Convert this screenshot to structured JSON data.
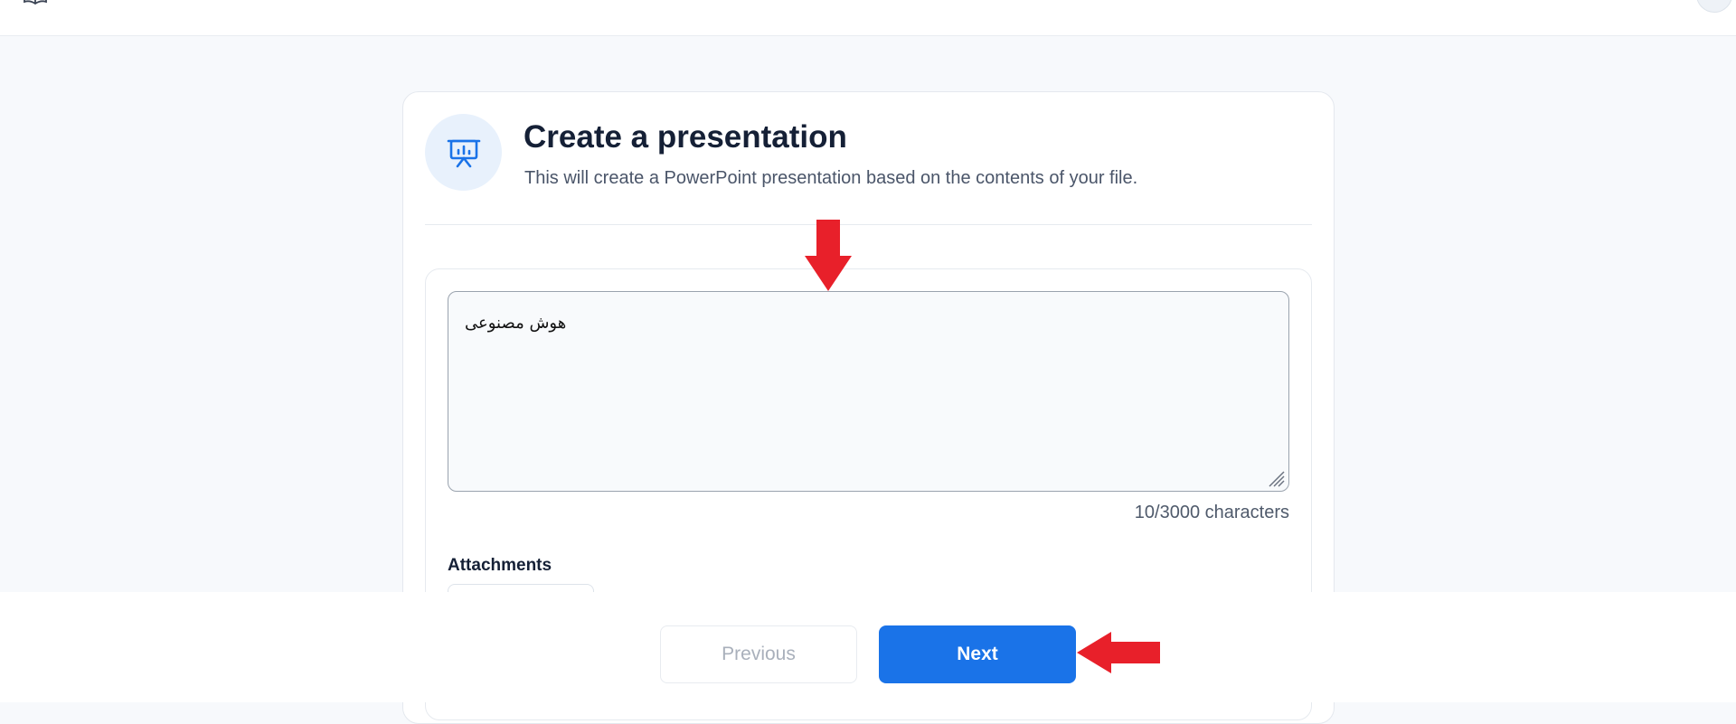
{
  "app": {
    "topbar": {
      "left_icon": "book-icon",
      "right_icon": "avatar"
    }
  },
  "card": {
    "icon": "presentation-board-icon",
    "title": "Create a presentation",
    "subtitle": "This will create a PowerPoint presentation based on the contents of your file.",
    "prompt": {
      "value": "هوش مصنوعی",
      "placeholder": ""
    },
    "char_count": "10/3000 characters",
    "attachments_label": "Attachments"
  },
  "footer": {
    "previous_label": "Previous",
    "next_label": "Next"
  },
  "colors": {
    "accent": "#1a73e8",
    "annotation": "#e8202a",
    "page_bg": "#f7f9fc"
  }
}
